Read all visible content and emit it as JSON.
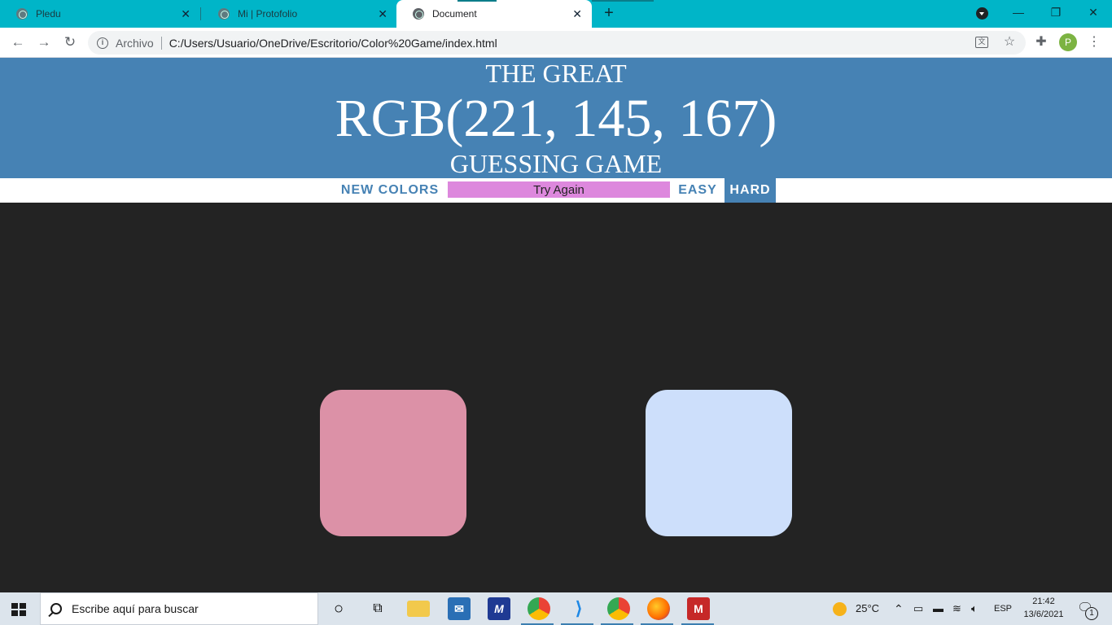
{
  "browser": {
    "tabs": [
      {
        "title": "Pledu"
      },
      {
        "title": "Mi | Protofolio"
      },
      {
        "title": "Document"
      }
    ],
    "new_tab": "+",
    "window_controls": {
      "minimize": "—",
      "restore": "❐",
      "close": "✕"
    },
    "address": {
      "scheme_label": "Archivo",
      "url": "C:/Users/Usuario/OneDrive/Escritorio/Color%20Game/index.html"
    },
    "profile_initial": "P"
  },
  "game": {
    "header": {
      "line1": "THE GREAT",
      "rgb": "RGB(221, 145, 167)",
      "line3": "GUESSING GAME"
    },
    "header_color": "#4682b4",
    "stripe": {
      "new_colors": "New Colors",
      "message": "Try Again",
      "easy": "Easy",
      "hard": "Hard"
    },
    "message_color": "#dd88dd",
    "squares": [
      {
        "color": "#dc91a7"
      },
      {
        "color": "#cddffb"
      }
    ],
    "background": "#232323"
  },
  "taskbar": {
    "search_placeholder": "Escribe aquí para buscar",
    "weather": "25°C",
    "language": "ESP",
    "time": "21:42",
    "date": "13/6/2021",
    "notification_count": "1"
  }
}
